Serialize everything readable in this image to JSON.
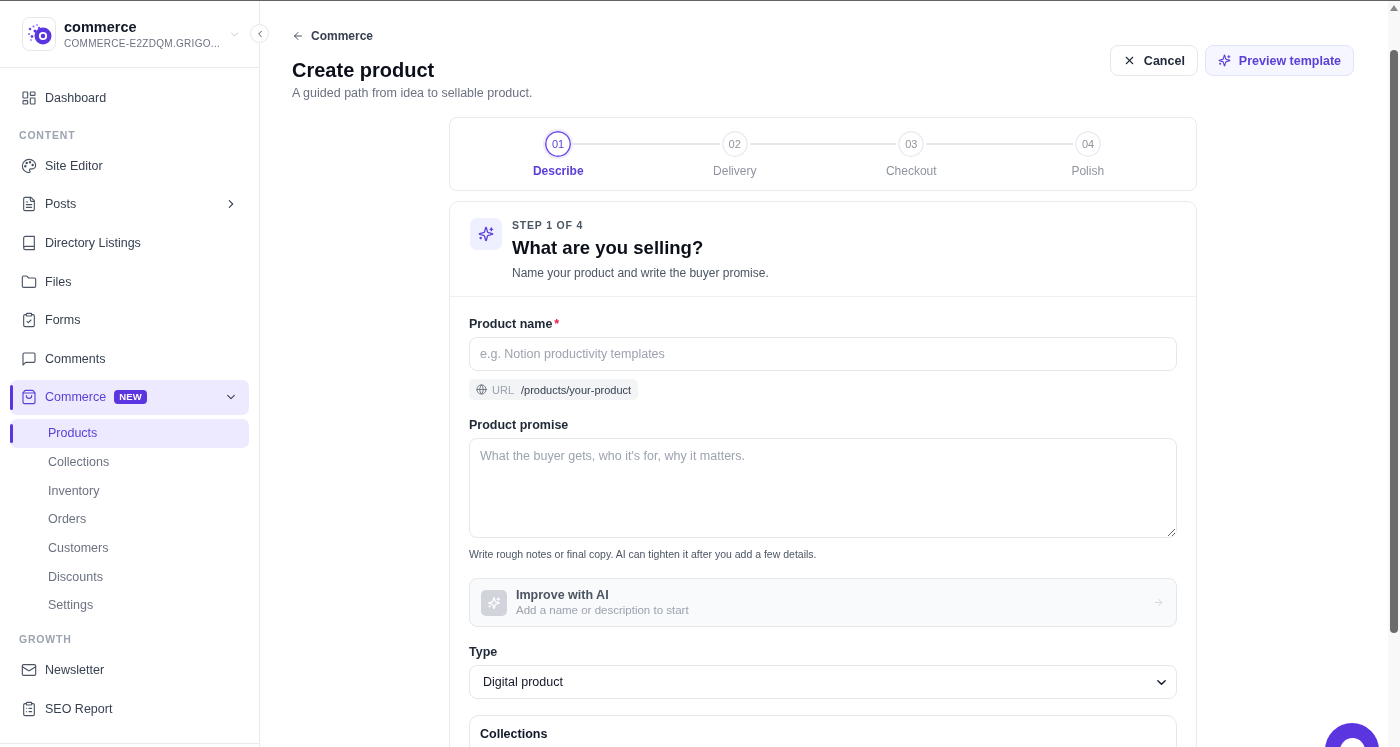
{
  "sidebar": {
    "workspace": {
      "name": "commerce",
      "subtitle": "COMMERCE-E2ZDQM.GRIGO..."
    },
    "sections": [
      {
        "items": [
          {
            "kind": "link",
            "label": "Dashboard",
            "selected": false
          }
        ]
      },
      {
        "heading": "CONTENT",
        "items": [
          {
            "kind": "link",
            "label": "Site Editor",
            "selected": false
          },
          {
            "kind": "group",
            "label": "Posts",
            "selected": false,
            "expanded": false
          },
          {
            "kind": "link",
            "label": "Directory Listings",
            "selected": false
          },
          {
            "kind": "link",
            "label": "Files",
            "selected": false
          },
          {
            "kind": "link",
            "label": "Forms",
            "selected": false
          },
          {
            "kind": "link",
            "label": "Comments",
            "selected": false
          },
          {
            "kind": "group",
            "label": "Commerce",
            "badge": "NEW",
            "selected": true,
            "expanded": true,
            "children": [
              {
                "label": "Products",
                "selected": true
              },
              {
                "label": "Collections",
                "selected": false
              },
              {
                "label": "Inventory",
                "selected": false
              },
              {
                "label": "Orders",
                "selected": false
              },
              {
                "label": "Customers",
                "selected": false
              },
              {
                "label": "Discounts",
                "selected": false
              },
              {
                "label": "Settings",
                "selected": false
              }
            ]
          }
        ]
      },
      {
        "heading": "GROWTH",
        "items": [
          {
            "kind": "link",
            "label": "Newsletter",
            "selected": false
          },
          {
            "kind": "link",
            "label": "SEO Report",
            "selected": false
          }
        ]
      }
    ]
  },
  "page": {
    "back_link": "Commerce",
    "title": "Create product",
    "subtitle": "A guided path from idea to sellable product.",
    "actions": [
      {
        "kind": "secondary",
        "label": "Cancel"
      },
      {
        "kind": "accent",
        "label": "Preview template"
      }
    ]
  },
  "stepper": [
    {
      "number": "01",
      "label": "Describe",
      "selected": true
    },
    {
      "number": "02",
      "label": "Delivery",
      "selected": false
    },
    {
      "number": "03",
      "label": "Checkout",
      "selected": false
    },
    {
      "number": "04",
      "label": "Polish",
      "selected": false
    }
  ],
  "step_card": {
    "eyebrow": "STEP 1 OF 4",
    "title": "What are you selling?",
    "subtitle": "Name your product and write the buyer promise.",
    "product_name": {
      "label": "Product name",
      "required_mark": "*",
      "placeholder": "e.g. Notion productivity templates"
    },
    "url_preview": {
      "prefix": "URL",
      "path": "/products/your-product"
    },
    "product_promise": {
      "label": "Product promise",
      "placeholder": "What the buyer gets, who it's for, why it matters.",
      "hint": "Write rough notes or final copy. AI can tighten it after you add a few details."
    },
    "ai_assist": {
      "title": "Improve with AI",
      "subtitle": "Add a name or description to start",
      "disabled": true
    },
    "type": {
      "label": "Type",
      "value": "Digital product"
    },
    "collections": {
      "title": "Collections"
    }
  }
}
